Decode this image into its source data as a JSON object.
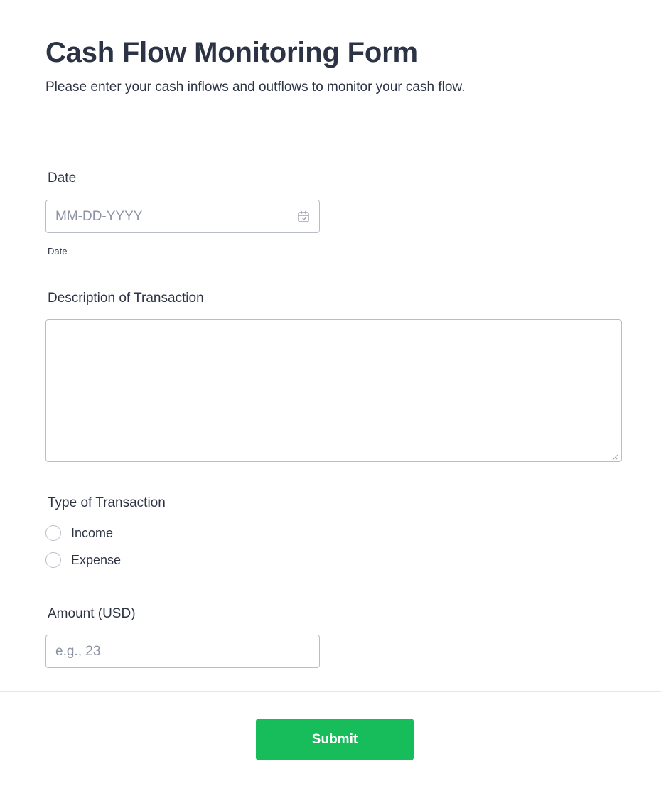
{
  "header": {
    "title": "Cash Flow Monitoring Form",
    "subtitle": "Please enter your cash inflows and outflows to monitor your cash flow."
  },
  "fields": {
    "date": {
      "label": "Date",
      "placeholder": "MM-DD-YYYY",
      "value": "",
      "sublabel": "Date",
      "icon": "calendar-icon"
    },
    "description": {
      "label": "Description of Transaction",
      "value": ""
    },
    "type": {
      "label": "Type of Transaction",
      "options": [
        "Income",
        "Expense"
      ],
      "selected": null
    },
    "amount": {
      "label": "Amount (USD)",
      "placeholder": "e.g., 23",
      "value": ""
    }
  },
  "footer": {
    "submit_label": "Submit"
  },
  "colors": {
    "text": "#2c3345",
    "border": "#b8bdc9",
    "placeholder": "#8d93a5",
    "submit": "#18bd5b"
  }
}
